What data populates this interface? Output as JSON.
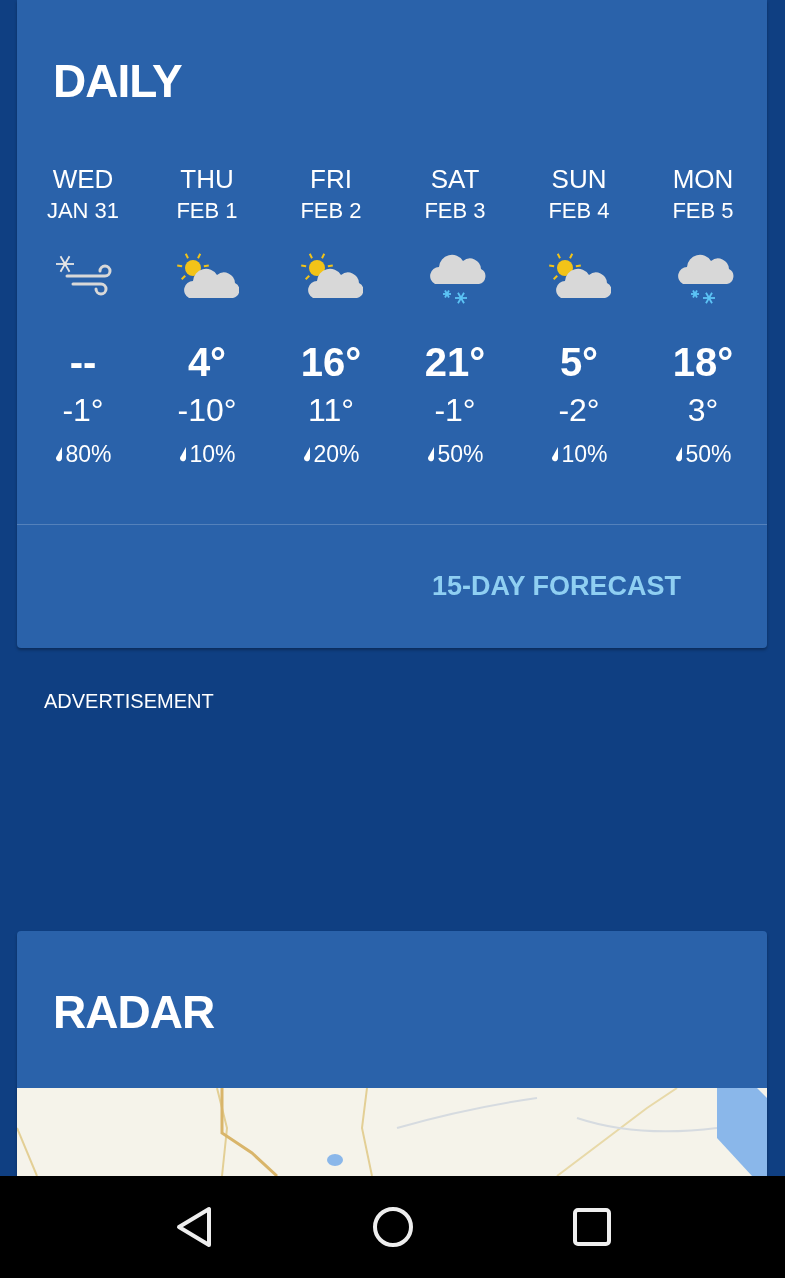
{
  "daily": {
    "title": "DAILY",
    "days": [
      {
        "day": "WED",
        "date": "JAN 31",
        "kind": "snow-wind",
        "high": "--",
        "low": "-1°",
        "precip": "80%"
      },
      {
        "day": "THU",
        "date": "FEB 1",
        "kind": "partly-cloudy",
        "high": "4°",
        "low": "-10°",
        "precip": "10%"
      },
      {
        "day": "FRI",
        "date": "FEB 2",
        "kind": "partly-cloudy",
        "high": "16°",
        "low": "11°",
        "precip": "20%"
      },
      {
        "day": "SAT",
        "date": "FEB 3",
        "kind": "cloud-snow",
        "high": "21°",
        "low": "-1°",
        "precip": "50%"
      },
      {
        "day": "SUN",
        "date": "FEB 4",
        "kind": "partly-cloudy",
        "high": "5°",
        "low": "-2°",
        "precip": "10%"
      },
      {
        "day": "MON",
        "date": "FEB 5",
        "kind": "cloud-snow",
        "high": "18°",
        "low": "3°",
        "precip": "50%"
      }
    ],
    "button": "15-DAY FORECAST"
  },
  "advertisement": "ADVERTISEMENT",
  "radar": {
    "title": "RADAR"
  }
}
